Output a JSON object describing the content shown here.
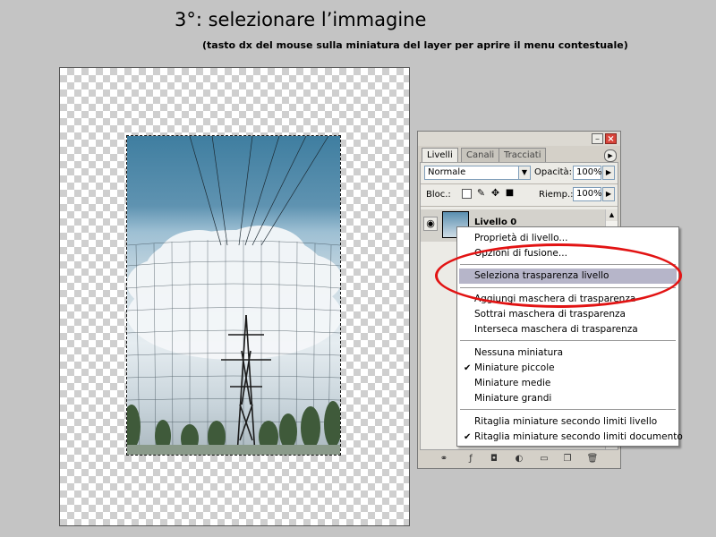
{
  "tutorial": {
    "title": "3°: selezionare l’immagine",
    "subtitle": "(tasto dx del mouse sulla miniatura del layer per aprire il menu contestuale)"
  },
  "panel": {
    "tabs": [
      {
        "label": "Livelli",
        "active": true
      },
      {
        "label": "Canali",
        "active": false
      },
      {
        "label": "Tracciati",
        "active": false
      }
    ],
    "blend_mode": "Normale",
    "opacity_label": "Opacità:",
    "opacity_value": "100%",
    "lock_label": "Bloc.:",
    "fill_label": "Riemp.:",
    "fill_value": "100%",
    "layer_name": "Livello 0"
  },
  "context_menu": {
    "items": [
      {
        "label": "Proprietà di livello...",
        "checked": false,
        "highlighted": false
      },
      {
        "label": "Opzioni di fusione...",
        "checked": false,
        "highlighted": false
      },
      {
        "label": "Seleziona trasparenza livello",
        "checked": false,
        "highlighted": true
      },
      {
        "label": "Aggiungi maschera di trasparenza",
        "checked": false,
        "highlighted": false
      },
      {
        "label": "Sottrai maschera di trasparenza",
        "checked": false,
        "highlighted": false
      },
      {
        "label": "Interseca maschera di trasparenza",
        "checked": false,
        "highlighted": false
      },
      {
        "label": "Nessuna miniatura",
        "checked": false,
        "highlighted": false
      },
      {
        "label": "Miniature piccole",
        "checked": true,
        "highlighted": false
      },
      {
        "label": "Miniature medie",
        "checked": false,
        "highlighted": false
      },
      {
        "label": "Miniature grandi",
        "checked": false,
        "highlighted": false
      },
      {
        "label": "Ritaglia miniature secondo limiti livello",
        "checked": false,
        "highlighted": false
      },
      {
        "label": "Ritaglia miniature secondo limiti documento",
        "checked": true,
        "highlighted": false
      }
    ]
  },
  "annotation": {
    "color": "#e21313"
  }
}
